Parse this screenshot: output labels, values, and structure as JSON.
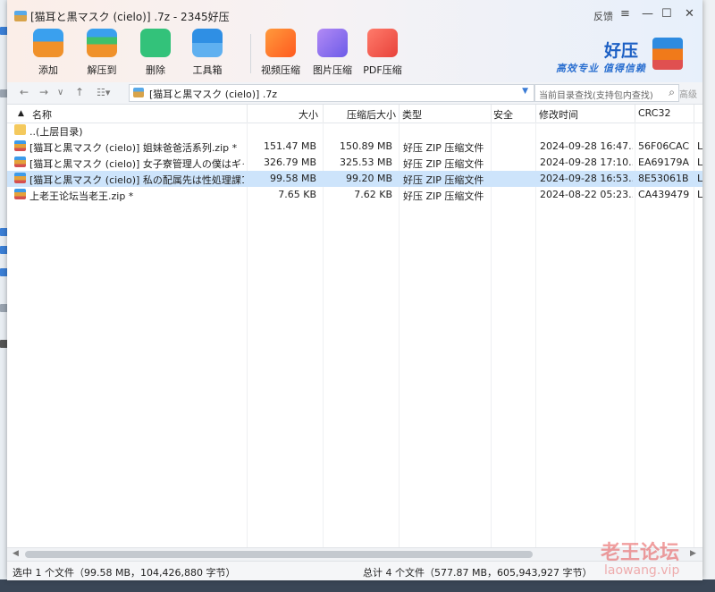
{
  "window": {
    "title": "[猫耳と黒マスク (cielo)] .7z - 2345好压",
    "feedback": "反馈",
    "menu_icon": "≡",
    "minimize": "—",
    "maximize": "☐",
    "close": "✕"
  },
  "toolbar": {
    "add": "添加",
    "extract": "解压到",
    "delete": "删除",
    "toolbox": "工具箱",
    "video": "视频压缩",
    "image": "图片压缩",
    "pdf": "PDF压缩"
  },
  "brand": {
    "title": "好压",
    "slogan": "高效专业 值得信赖"
  },
  "address": {
    "path": "[猫耳と黒マスク (cielo)] .7z",
    "search_placeholder": "当前目录查找(支持包内查找)",
    "advanced": "高级"
  },
  "columns": {
    "name": "名称",
    "size": "大小",
    "packed": "压缩后大小",
    "type": "类型",
    "security": "安全",
    "modified": "修改时间",
    "crc": "CRC32"
  },
  "rows": [
    {
      "name": "..(上层目录)",
      "size": "",
      "packed": "",
      "type": "",
      "modified": "",
      "crc": ""
    },
    {
      "name": "[猫耳と黒マスク (cielo)] 姐妹爸爸活系列.zip *",
      "size": "151.47 MB",
      "packed": "150.89 MB",
      "type": "好压 ZIP 压缩文件",
      "modified": "2024-09-28 16:47...",
      "crc": "56F06CAC"
    },
    {
      "name": "[猫耳と黒マスク (cielo)] 女子寮管理人の僕はギャ...",
      "size": "326.79 MB",
      "packed": "325.53 MB",
      "type": "好压 ZIP 压缩文件",
      "modified": "2024-09-28 17:10...",
      "crc": "EA69179A"
    },
    {
      "name": "[猫耳と黒マスク (cielo)] 私の配属先は性処理課1-2...",
      "size": "99.58 MB",
      "packed": "99.20 MB",
      "type": "好压 ZIP 压缩文件",
      "modified": "2024-09-28 16:53...",
      "crc": "8E53061B"
    },
    {
      "name": "上老王论坛当老王.zip *",
      "size": "7.65 KB",
      "packed": "7.62 KB",
      "type": "好压 ZIP 压缩文件",
      "modified": "2024-08-22 05:23...",
      "crc": "CA439479"
    }
  ],
  "status": {
    "selected": "选中 1 个文件（99.58 MB，104,426,880 字节）",
    "total": "总计 4 个文件（577.87 MB，605,943,927 字节）"
  },
  "watermark": {
    "text": "老王论坛",
    "url": "laowang.vip"
  },
  "colors": {
    "accent": "#1c5fc4",
    "selected_row": "#cde4fb"
  }
}
